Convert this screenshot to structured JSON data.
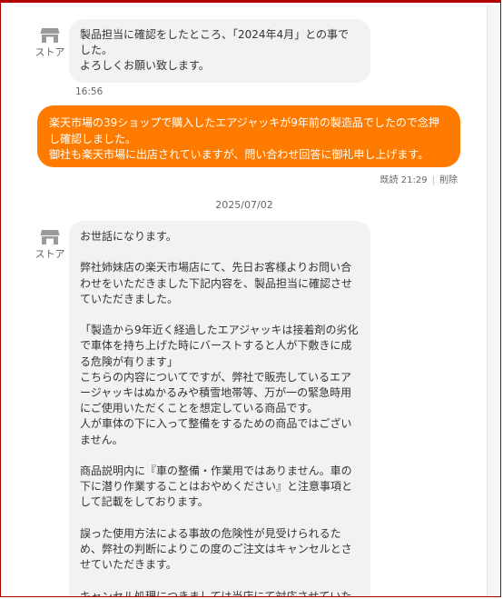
{
  "messages": {
    "first": {
      "sender": "ストア",
      "text": "製品担当に確認をしたところ、「2024年4月」との事でした。\nよろしくお願い致します。",
      "time": "16:56"
    },
    "reply": {
      "text": "楽天市場の39ショップで購入したエアジャッキが9年前の製造品でしたので念押し確認しました。\n御社も楽天市場に出店されていますが、問い合わせ回答に御礼申し上げます。",
      "read_status": "既読 21:29",
      "delete_label": "削除"
    },
    "date_separator": "2025/07/02",
    "second": {
      "sender": "ストア",
      "text": "お世話になります。\n\n弊社姉妹店の楽天市場店にて、先日お客様よりお問い合わせをいただきました下記内容を、製品担当に確認させていただきました。\n\n「製造から9年近く経過したエアジャッキは接着剤の劣化で車体を持ち上げた時にバーストすると人が下敷きに成る危険が有ります」\nこちらの内容についてですが、弊社で販売しているエアージャッキはぬかるみや積雪地帯等、万が一の緊急時用にご使用いただくことを想定している商品です。\n人が車体の下に入って整備をするための商品ではございません。\n\n商品説明内に『車の整備・作業用ではありません。車の下に潜り作業することはおやめください』と注意事項として記載をしております。\n\n誤った使用方法による事故の危険性が見受けられるため、弊社の判断によりこの度のご注文はキャンセルとさせていただきます。\n\nキャンセル処理につきましては当店にて対応させていただ"
    }
  },
  "colors": {
    "outgoing_bubble": "#ff7b00",
    "incoming_bubble": "#f2f2f2",
    "frame_border": "#b10000"
  },
  "icons": {
    "store": "store-icon"
  }
}
